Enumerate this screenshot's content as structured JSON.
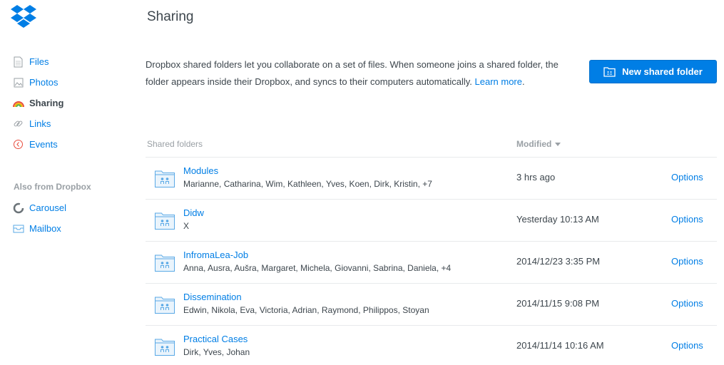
{
  "sidebar": {
    "logo": "dropbox-logo",
    "items": [
      {
        "label": "Files",
        "icon": "file-icon"
      },
      {
        "label": "Photos",
        "icon": "photo-icon"
      },
      {
        "label": "Sharing",
        "icon": "rainbow-icon",
        "active": true
      },
      {
        "label": "Links",
        "icon": "link-icon"
      },
      {
        "label": "Events",
        "icon": "clock-icon"
      }
    ],
    "also_heading": "Also from Dropbox",
    "also_items": [
      {
        "label": "Carousel",
        "icon": "carousel-icon"
      },
      {
        "label": "Mailbox",
        "icon": "mailbox-icon"
      }
    ]
  },
  "page": {
    "title": "Sharing",
    "description": "Dropbox shared folders let you collaborate on a set of files. When someone joins a shared folder, the folder appears inside their Dropbox, and syncs to their computers automatically.",
    "learn_more": "Learn more",
    "period": ".",
    "new_button": "New shared folder"
  },
  "table": {
    "col_name": "Shared folders",
    "col_modified": "Modified",
    "rows": [
      {
        "name": "Modules",
        "members": "Marianne, Catharina, Wim, Kathleen, Yves, Koen, Dirk, Kristin, +7",
        "modified": "3 hrs ago",
        "options": "Options"
      },
      {
        "name": "Didw",
        "members": "X",
        "modified": "Yesterday 10:13 AM",
        "options": "Options"
      },
      {
        "name": "InfromaLea-Job",
        "members": "Anna, Ausra, Aušra, Margaret, Michela, Giovanni, Sabrina, Daniela, +4",
        "modified": "2014/12/23 3:35 PM",
        "options": "Options"
      },
      {
        "name": "Dissemination",
        "members": "Edwin, Nikola, Eva, Victoria, Adrian, Raymond, Philippos, Stoyan",
        "modified": "2014/11/15 9:08 PM",
        "options": "Options"
      },
      {
        "name": "Practical Cases",
        "members": "Dirk, Yves, Johan",
        "modified": "2014/11/14 10:16 AM",
        "options": "Options"
      }
    ]
  },
  "colors": {
    "accent": "#007ee5",
    "text": "#3d464d",
    "muted": "#9aa0a5",
    "divider": "#e8eaec"
  }
}
